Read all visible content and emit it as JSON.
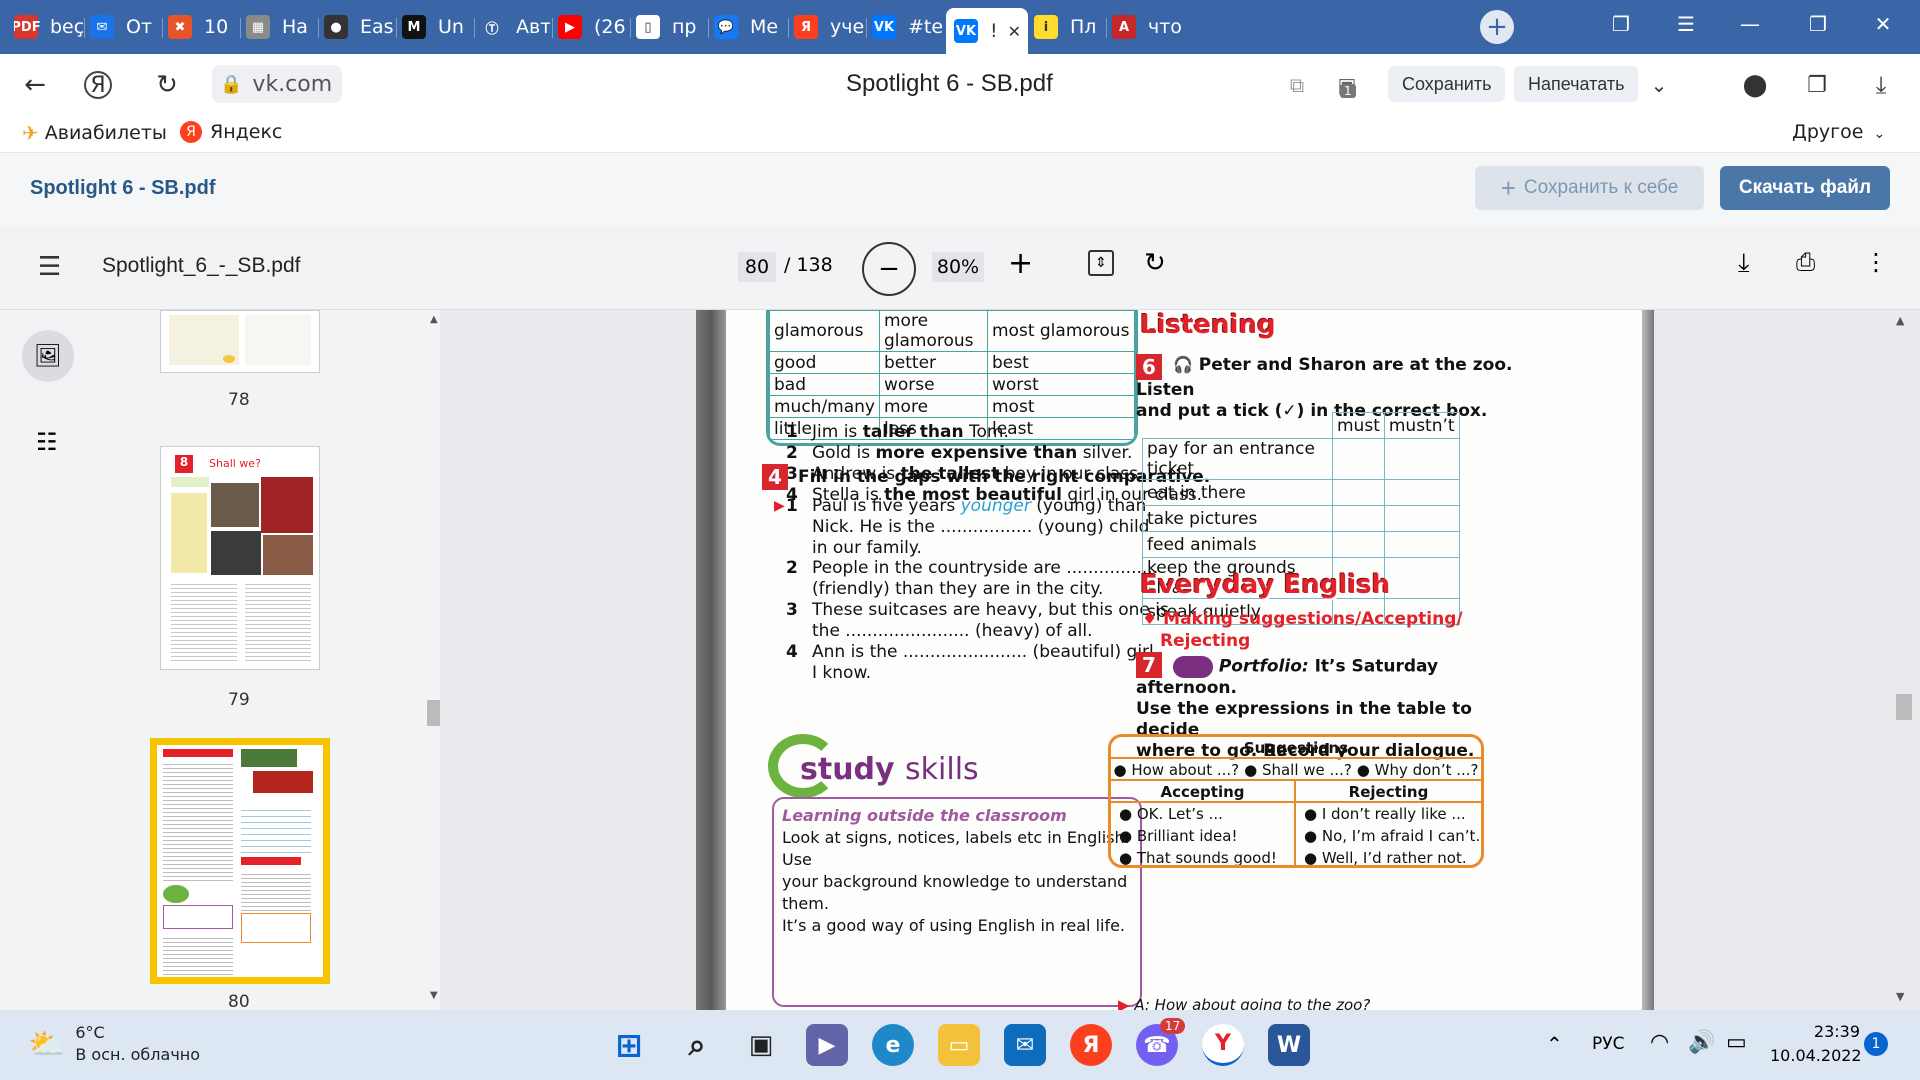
{
  "tabs": [
    {
      "label": "beç",
      "color": "#d9362e",
      "glyph": "PDF"
    },
    {
      "label": "От",
      "color": "#1a73e8",
      "glyph": "✉"
    },
    {
      "label": "10",
      "color": "#e8542a",
      "glyph": "✖"
    },
    {
      "label": "На",
      "color": "#8a8a8a",
      "glyph": "▦"
    },
    {
      "label": "Eas",
      "color": "#333333",
      "glyph": "●"
    },
    {
      "label": "Un",
      "color": "#111111",
      "glyph": "M"
    },
    {
      "label": "Авт",
      "color": "#3a66a7",
      "glyph": "Ⓣ"
    },
    {
      "label": "(26",
      "color": "#ff0000",
      "glyph": "▶"
    },
    {
      "label": "пр",
      "color": "#ffffff",
      "glyph": "▯"
    },
    {
      "label": "Me",
      "color": "#1877f2",
      "glyph": "💬"
    },
    {
      "label": "уче",
      "color": "#fc3f1d",
      "glyph": "Я"
    },
    {
      "label": "#te",
      "color": "#0077ff",
      "glyph": "VK"
    },
    {
      "label": "!",
      "color": "#0077ff",
      "glyph": "VK",
      "active": true
    },
    {
      "label": "Пл",
      "color": "#ffdd2d",
      "glyph": "i"
    },
    {
      "label": "что",
      "color": "#c62828",
      "glyph": "A"
    }
  ],
  "address": {
    "url": "vk.com",
    "page_title": "Spotlight 6 - SB.pdf",
    "save_label": "Сохранить",
    "print_label": "Напечатать",
    "ext_badge": "1"
  },
  "bookmarks": {
    "item1": "Авиабилеты",
    "item2": "Яндекс",
    "other": "Другое"
  },
  "vk_header": {
    "title": "Spotlight 6 - SB.pdf",
    "save_to_self": "Сохранить к себе",
    "download": "Скачать файл"
  },
  "pdf_toolbar": {
    "filename": "Spotlight_6_-_SB.pdf",
    "page_current": "80",
    "page_total": "/ 138",
    "zoom": "80%"
  },
  "thumbnails": [
    {
      "page": "78"
    },
    {
      "page": "79",
      "title": "Shall we?",
      "badge": "8"
    },
    {
      "page": "80",
      "selected": true
    }
  ],
  "page": {
    "comparison_table": [
      [
        "glamorous",
        "more glamorous",
        "most glamorous"
      ],
      [
        "good",
        "better",
        "best"
      ],
      [
        "bad",
        "worse",
        "worst"
      ],
      [
        "much/many",
        "more",
        "most"
      ],
      [
        "little",
        "less",
        "least"
      ]
    ],
    "examples": [
      {
        "n": "1",
        "pre": "Jim is ",
        "bold": "taller than",
        "post": " Tom."
      },
      {
        "n": "2",
        "pre": "Gold is ",
        "bold": "more expensive than",
        "post": " silver."
      },
      {
        "n": "3",
        "pre": "Andrew is ",
        "bold": "the tallest",
        "post": " boy in our class."
      },
      {
        "n": "4",
        "pre": "Stella is ",
        "bold": "the most beautiful",
        "post": " girl in our class."
      }
    ],
    "ex4": {
      "num": "4",
      "instruction": "Fill in the gaps with the right comparative.",
      "items": [
        {
          "n": "1",
          "l1a": "Paul  is  five  years ",
          "answer": "younger",
          "l1b": " (young) than",
          "l2": "Nick. He is the ................. (young) child",
          "l3": "in our family."
        },
        {
          "n": "2",
          "l1a": "People in the countryside are .................",
          "l2": "(friendly) than they are in the city."
        },
        {
          "n": "3",
          "l1a": "These  suitcases  are  heavy,  but  this  one  is",
          "l2": "the ....................... (heavy) of all."
        },
        {
          "n": "4",
          "l1a": "Ann is the ....................... (beautiful) girl",
          "l2": "I know."
        }
      ]
    },
    "study_skills": {
      "word1": "study",
      "word2": "skills",
      "subtitle": "Learning outside the classroom",
      "lines": [
        "Look at signs, notices, labels etc in English. Use",
        "your background knowledge to understand them.",
        "It’s a good way of using English in real life."
      ]
    },
    "listening": {
      "heading": "Listening",
      "num": "6",
      "line1": "Peter and Sharon are at the zoo. Listen",
      "line2": "and put a tick (✓) in the correct box.",
      "col_must": "must",
      "col_mustnt": "mustn’t",
      "rows": [
        "pay for an entrance ticket",
        "eat in there",
        "take pictures",
        "feed animals",
        "keep the grounds clean",
        "speak quietly"
      ]
    },
    "everyday": {
      "heading": "Everyday English",
      "sub1": "Making suggestions/Accepting/",
      "sub2": "Rejecting",
      "num": "7",
      "portfolio_label": "Portfolio:",
      "line1": " It’s Saturday afternoon.",
      "line2": "Use the expressions in the table to decide",
      "line3": "where to go. Record your dialogue.",
      "suggestions_title": "Suggestions",
      "suggestions": [
        "How about ...?",
        "Shall we ...?",
        "Why don’t ...?"
      ],
      "accepting_title": "Accepting",
      "accepting": [
        "OK. Let’s ...",
        "Brilliant idea!",
        "That sounds good!"
      ],
      "rejecting_title": "Rejecting",
      "rejecting": [
        "I don’t really like ...",
        "No, I’m afraid I can’t.",
        "Well, I’d rather not."
      ],
      "dialogue_start": "A: How about going to the zoo?"
    }
  },
  "taskbar": {
    "temp": "6°C",
    "weather": "В осн. облачно",
    "lang": "РУС",
    "time": "23:39",
    "date": "10.04.2022",
    "viber_badge": "17",
    "notif_badge": "1"
  },
  "colors": {
    "tabstrip": "#3a66a7",
    "vk_blue": "#4a76a8",
    "red_heading": "#e4202a",
    "teal_border": "#4aa3a0",
    "answer_blue": "#2a9fd6"
  }
}
